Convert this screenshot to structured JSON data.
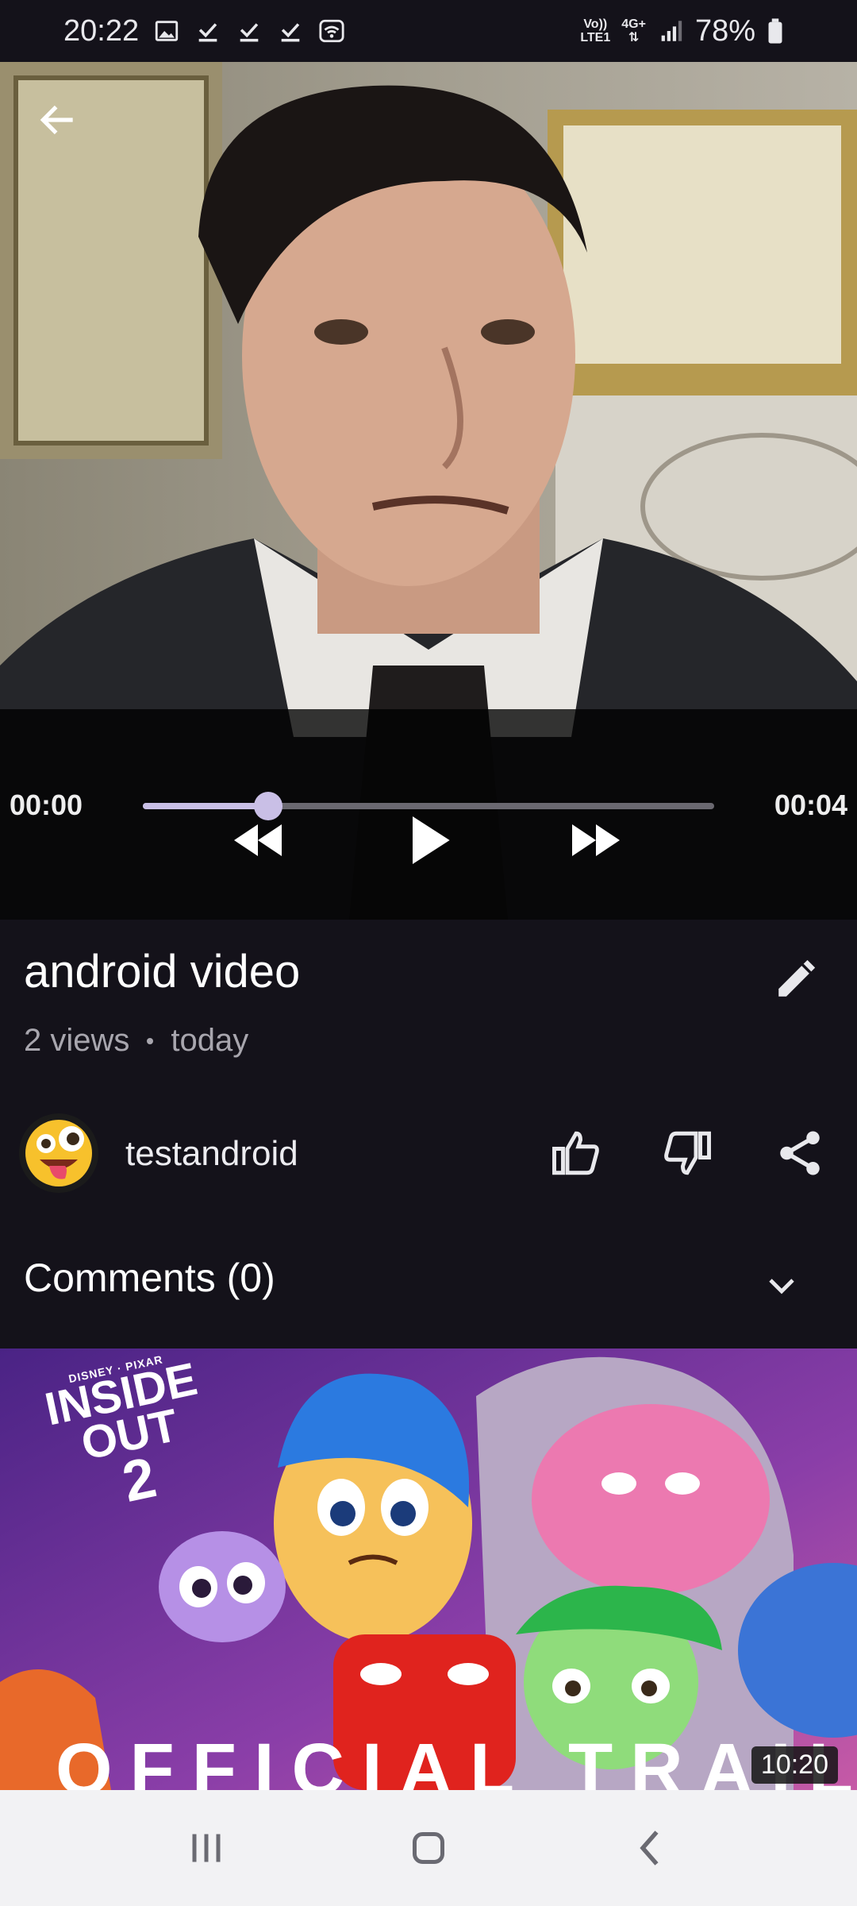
{
  "status_bar": {
    "time": "20:22",
    "network_top": "Vo))",
    "network_bottom": "LTE1",
    "network_type": "4G+",
    "battery": "78%",
    "left_icons": [
      "image-icon",
      "download-done-icon",
      "download-done-icon",
      "download-done-icon",
      "wifi-hotspot-icon"
    ]
  },
  "player": {
    "current_time": "00:00",
    "total_time": "00:04",
    "progress": 0.22
  },
  "video": {
    "title": "android video",
    "views": "2 views",
    "date": "today"
  },
  "channel": {
    "name": "testandroid"
  },
  "comments": {
    "label": "Comments (0)"
  },
  "next_video": {
    "logo_line1": "INSIDE",
    "logo_line2": "OUT",
    "logo_line3": "2",
    "logo_small": "DISNEY · PIXAR",
    "overlay_text": "OFFICIAL TRAILER",
    "duration": "10:20"
  },
  "colors": {
    "background": "#14121a",
    "accent": "#c9bfe6",
    "nav_bar": "#f2f2f4"
  }
}
